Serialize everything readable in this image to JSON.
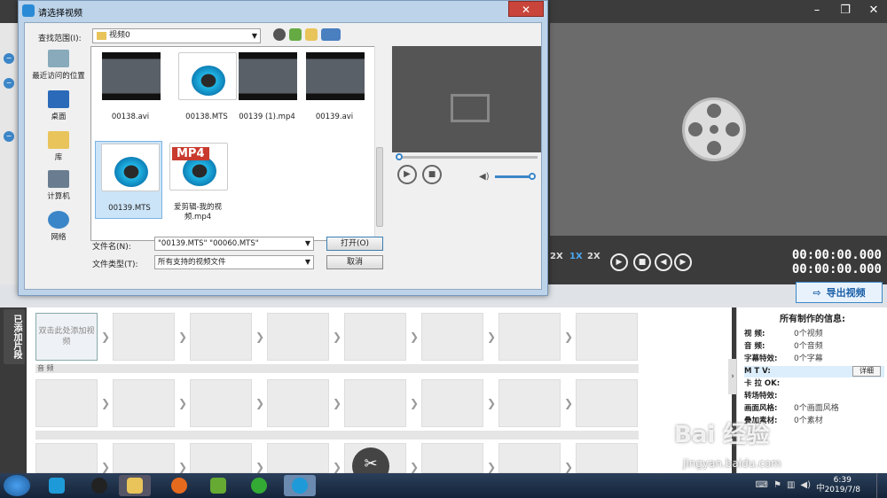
{
  "dialog": {
    "title": "请选择视频",
    "close_label": "✕",
    "look_in_label": "查找范围(I):",
    "look_in_value": "视频0",
    "places": [
      {
        "label": "最近访问的位置"
      },
      {
        "label": "桌面"
      },
      {
        "label": "库"
      },
      {
        "label": "计算机"
      },
      {
        "label": "网络"
      }
    ],
    "files": [
      {
        "name": "00138.avi",
        "kind": "video"
      },
      {
        "name": "00138.MTS",
        "kind": "mts"
      },
      {
        "name": "00139 (1).mp4",
        "kind": "video"
      },
      {
        "name": "00139.avi",
        "kind": "video"
      },
      {
        "name": "00139.MTS",
        "kind": "mts",
        "selected": true
      },
      {
        "name": "爱剪辑-我的视频.mp4",
        "kind": "mp4"
      }
    ],
    "mp4_badge": "MP4",
    "filename_label": "文件名(N):",
    "filename_value": "\"00139.MTS\" \"00060.MTS\"",
    "filetype_label": "文件类型(T):",
    "filetype_value": "所有支持的视频文件",
    "open_label": "打开(O)",
    "cancel_label": "取消"
  },
  "app": {
    "speed_labels": [
      "2X",
      "1X",
      "2X"
    ],
    "timecode_1": "00:00:00.000",
    "timecode_2": "00:00:00.000",
    "export_label": "导出视频",
    "added_clips_label": "已添加片段",
    "add_clip_label": "双击此处添加视频",
    "audio_label": "音 频",
    "info": {
      "title": "所有制作的信息:",
      "rows": [
        {
          "k": "视    频:",
          "v": "0个视频"
        },
        {
          "k": "音    频:",
          "v": "0个音频"
        },
        {
          "k": "字幕特效:",
          "v": "0个字幕"
        },
        {
          "k": "M  T  V:",
          "v": ""
        },
        {
          "k": "卡  拉 OK:",
          "v": ""
        },
        {
          "k": "转场特效:",
          "v": ""
        },
        {
          "k": "画面风格:",
          "v": "0个画面风格"
        },
        {
          "k": "叠加素材:",
          "v": "0个素材"
        }
      ],
      "detail_label": "详细"
    }
  },
  "taskbar": {
    "time": "6:39",
    "date": "2019/7/8"
  },
  "watermark": {
    "line1": "Bai 经验",
    "line2": "jingyan.baidu.com"
  },
  "colors": {
    "accent": "#3b86c8",
    "dialog_frame": "#bcd3ea",
    "close_red": "#c9453b"
  }
}
